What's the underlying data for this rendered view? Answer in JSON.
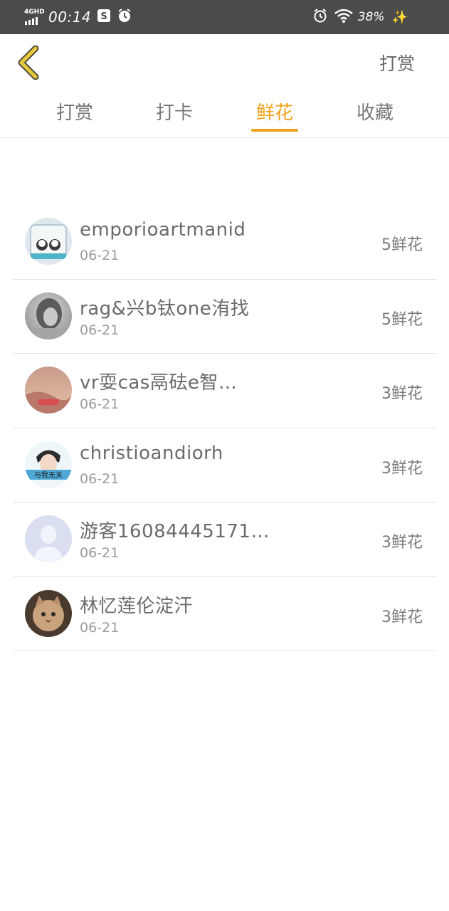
{
  "status_bar": {
    "network": "4GHD",
    "time": "00:14",
    "battery": "38%"
  },
  "header": {
    "action_label": "打赏"
  },
  "tabs": [
    {
      "label": "打赏",
      "active": false
    },
    {
      "label": "打卡",
      "active": false
    },
    {
      "label": "鲜花",
      "active": true
    },
    {
      "label": "收藏",
      "active": false
    }
  ],
  "colors": {
    "accent": "#f0a11a",
    "status_bar_bg": "#4b4b4b",
    "back_arrow": "#e7c93c"
  },
  "items": [
    {
      "name": "emporioartmanid",
      "date": "06-21",
      "count": "5鲜花"
    },
    {
      "name": "rag&兴b钛one洧找",
      "date": "06-21",
      "count": "5鲜花"
    },
    {
      "name": "vr耍cas鬲砝e智…",
      "date": "06-21",
      "count": "3鲜花"
    },
    {
      "name": "christioandiorh",
      "date": "06-21",
      "count": "3鲜花"
    },
    {
      "name": "游客16084445171…",
      "date": "06-21",
      "count": "3鲜花"
    },
    {
      "name": "林忆莲伦淀汗",
      "date": "06-21",
      "count": "3鲜花"
    }
  ],
  "avatar_badge_text": "与我无关"
}
